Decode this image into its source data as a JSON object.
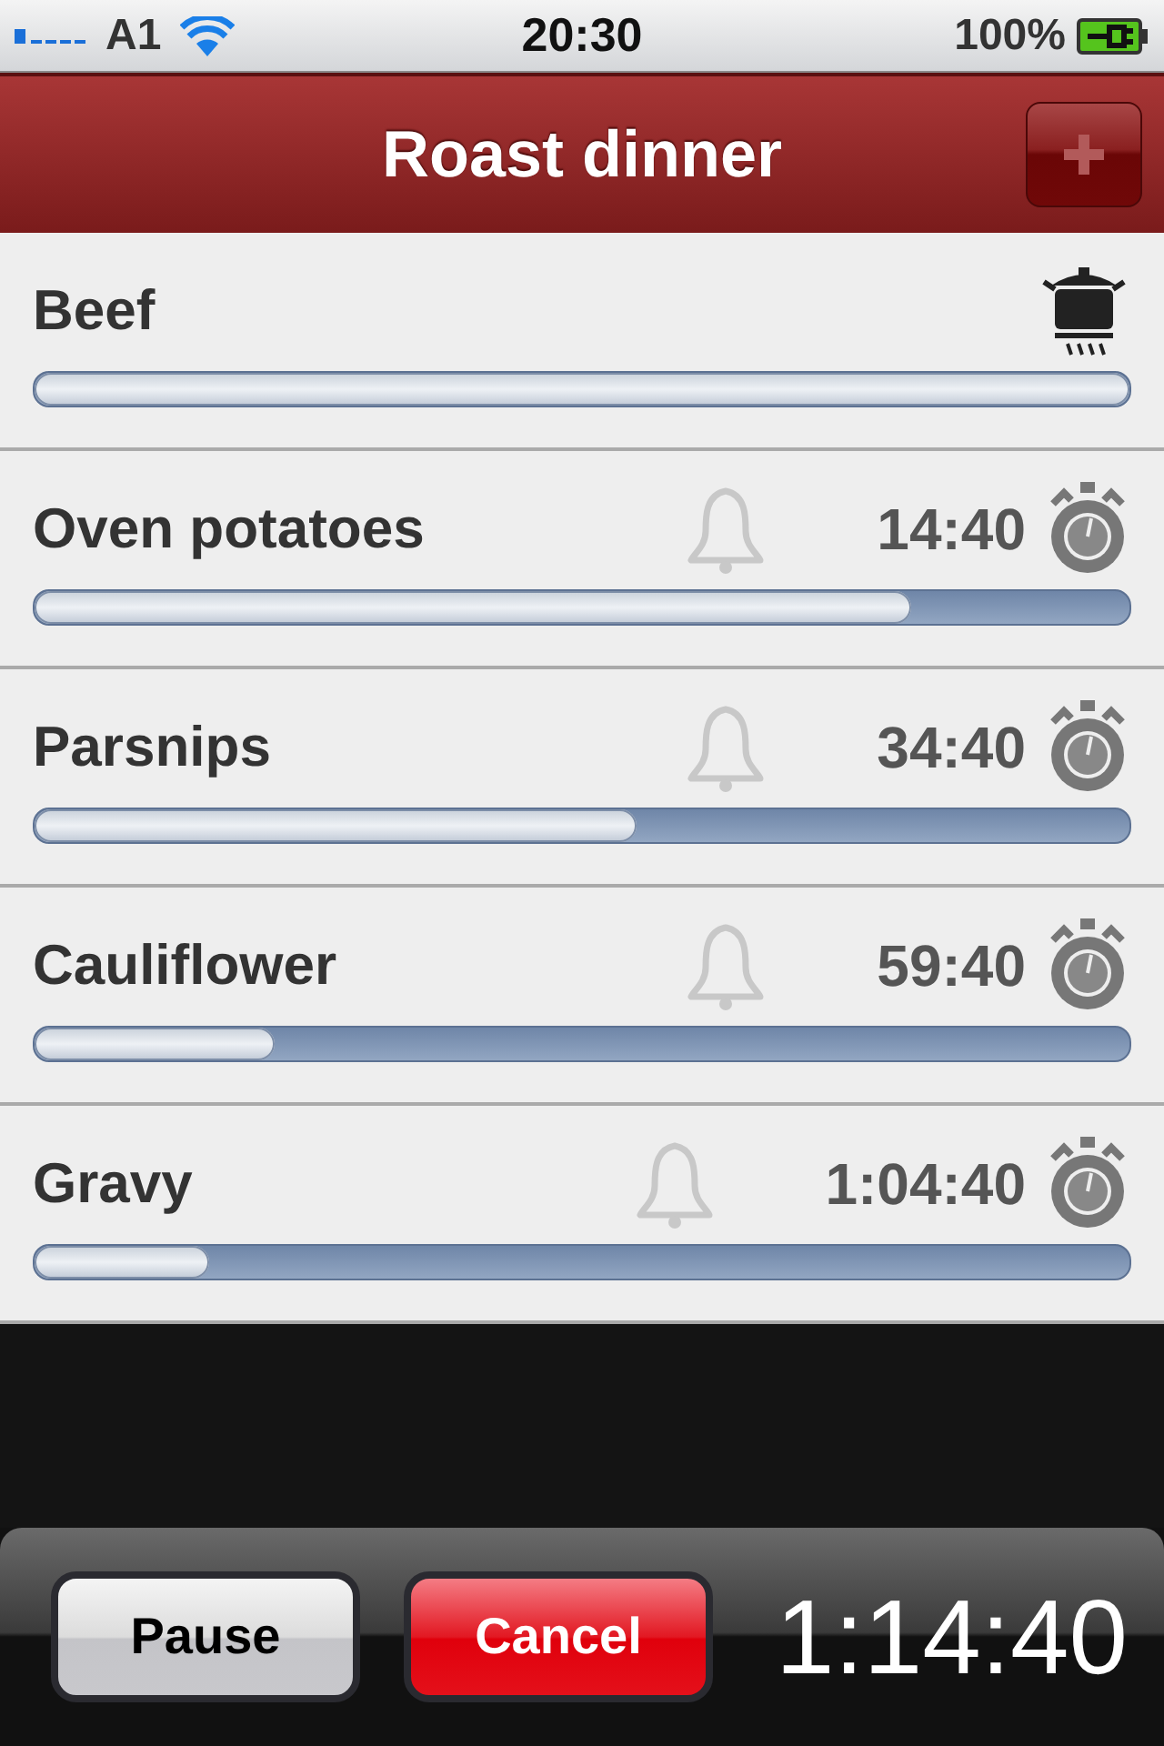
{
  "status_bar": {
    "carrier": "A1",
    "time": "20:30",
    "battery": "100%"
  },
  "nav_bar": {
    "title": "Roast dinner"
  },
  "items": [
    {
      "kind": "cooking",
      "name": "Beef",
      "level": 1
    },
    {
      "kind": "timer",
      "name": "Oven potatoes",
      "time": "14:40",
      "level": 0.8
    },
    {
      "kind": "timer",
      "name": "Parsnips",
      "time": "34:40",
      "level": 0.55
    },
    {
      "kind": "timer",
      "name": "Cauliflower",
      "time": "59:40",
      "level": 0.22
    },
    {
      "kind": "timer",
      "name": "Gravy",
      "time": "1:04:40",
      "level": 0.16
    }
  ],
  "toolbar": {
    "pause": "Pause",
    "cancel": "Cancel",
    "total_time": "1:14:40"
  }
}
